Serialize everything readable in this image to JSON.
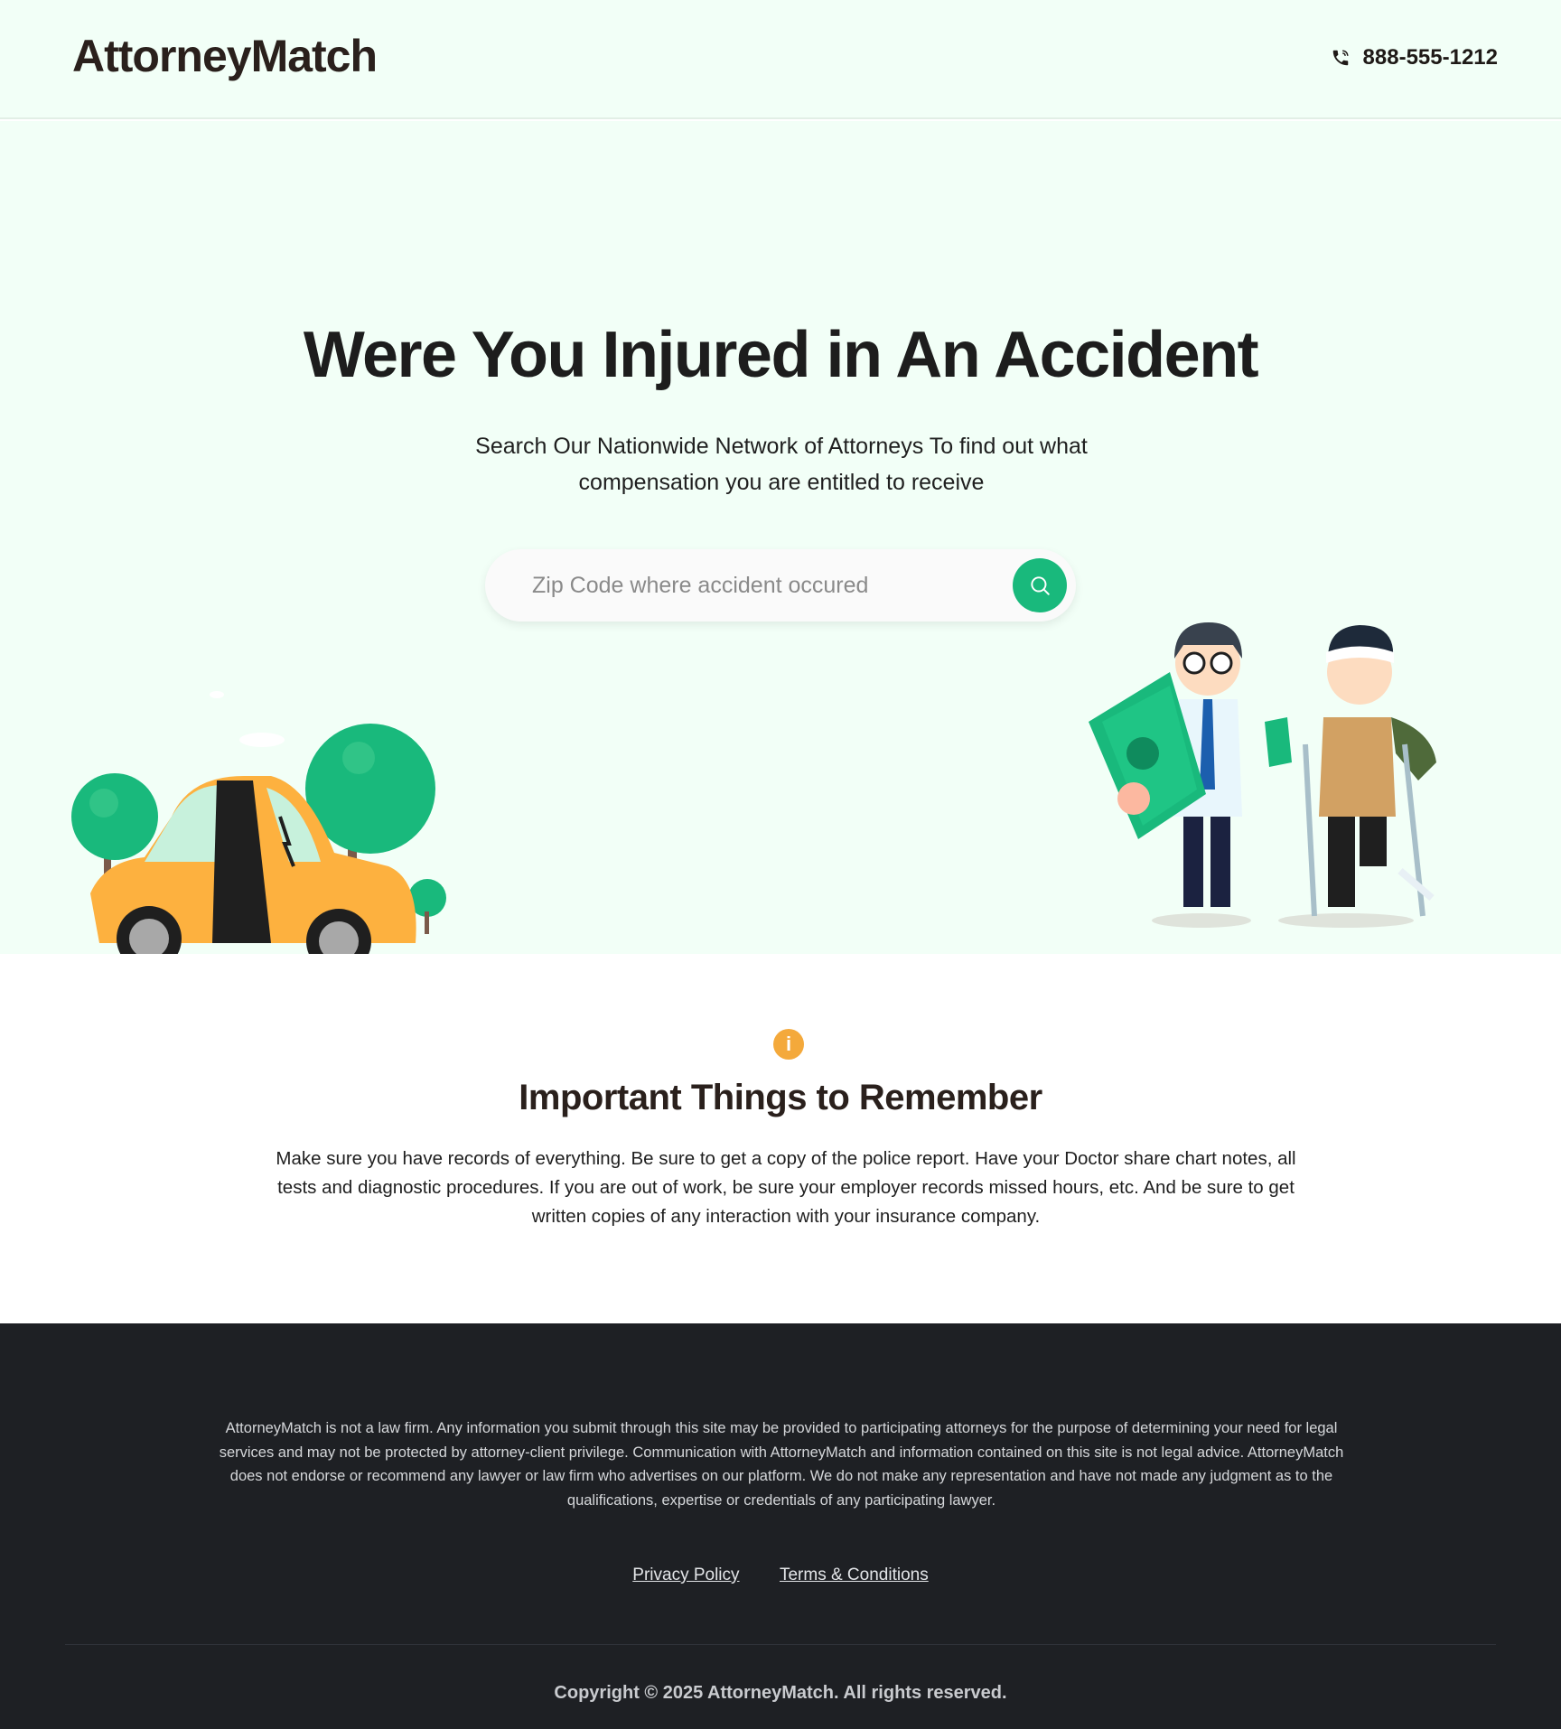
{
  "header": {
    "logo": "AttorneyMatch",
    "phone": "888-555-1212"
  },
  "hero": {
    "title": "Were You Injured in An Accident",
    "subtitle": "Search Our Nationwide Network of Attorneys  To find out what compensation you are entitled to receive",
    "search_placeholder": "Zip Code where accident occured"
  },
  "info": {
    "icon_label": "i",
    "title": "Important Things to Remember",
    "text": "Make sure you have records of everything. Be sure to get a copy of the police report.  Have your Doctor share chart notes, all tests and diagnostic procedures. If you are out of work, be sure your employer records missed hours, etc.  And be sure to get written copies of any interaction with your insurance company."
  },
  "footer": {
    "disclaimer": "AttorneyMatch is not a law firm.  Any information you submit through this site may be provided to participating attorneys for the purpose of determining your need for legal services and may not be protected by attorney-client privilege. Communication with AttorneyMatch and information contained on this site is not legal advice. AttorneyMatch does not endorse or recommend any lawyer or law firm who advertises on our platform. We do not make any representation and have not made any judgment as to the qualifications, expertise or credentials of any participating lawyer.",
    "links": [
      "Privacy Policy",
      "Terms & Conditions"
    ],
    "copyright": "Copyright © 2025 AttorneyMatch. All rights reserved."
  },
  "colors": {
    "accent": "#19b97c",
    "hero_bg": "#f2fff7",
    "footer_bg": "#1e2024",
    "info_icon": "#f4a93b"
  },
  "icons": {
    "phone": "phone-icon",
    "search": "search-icon",
    "info": "info-icon"
  }
}
